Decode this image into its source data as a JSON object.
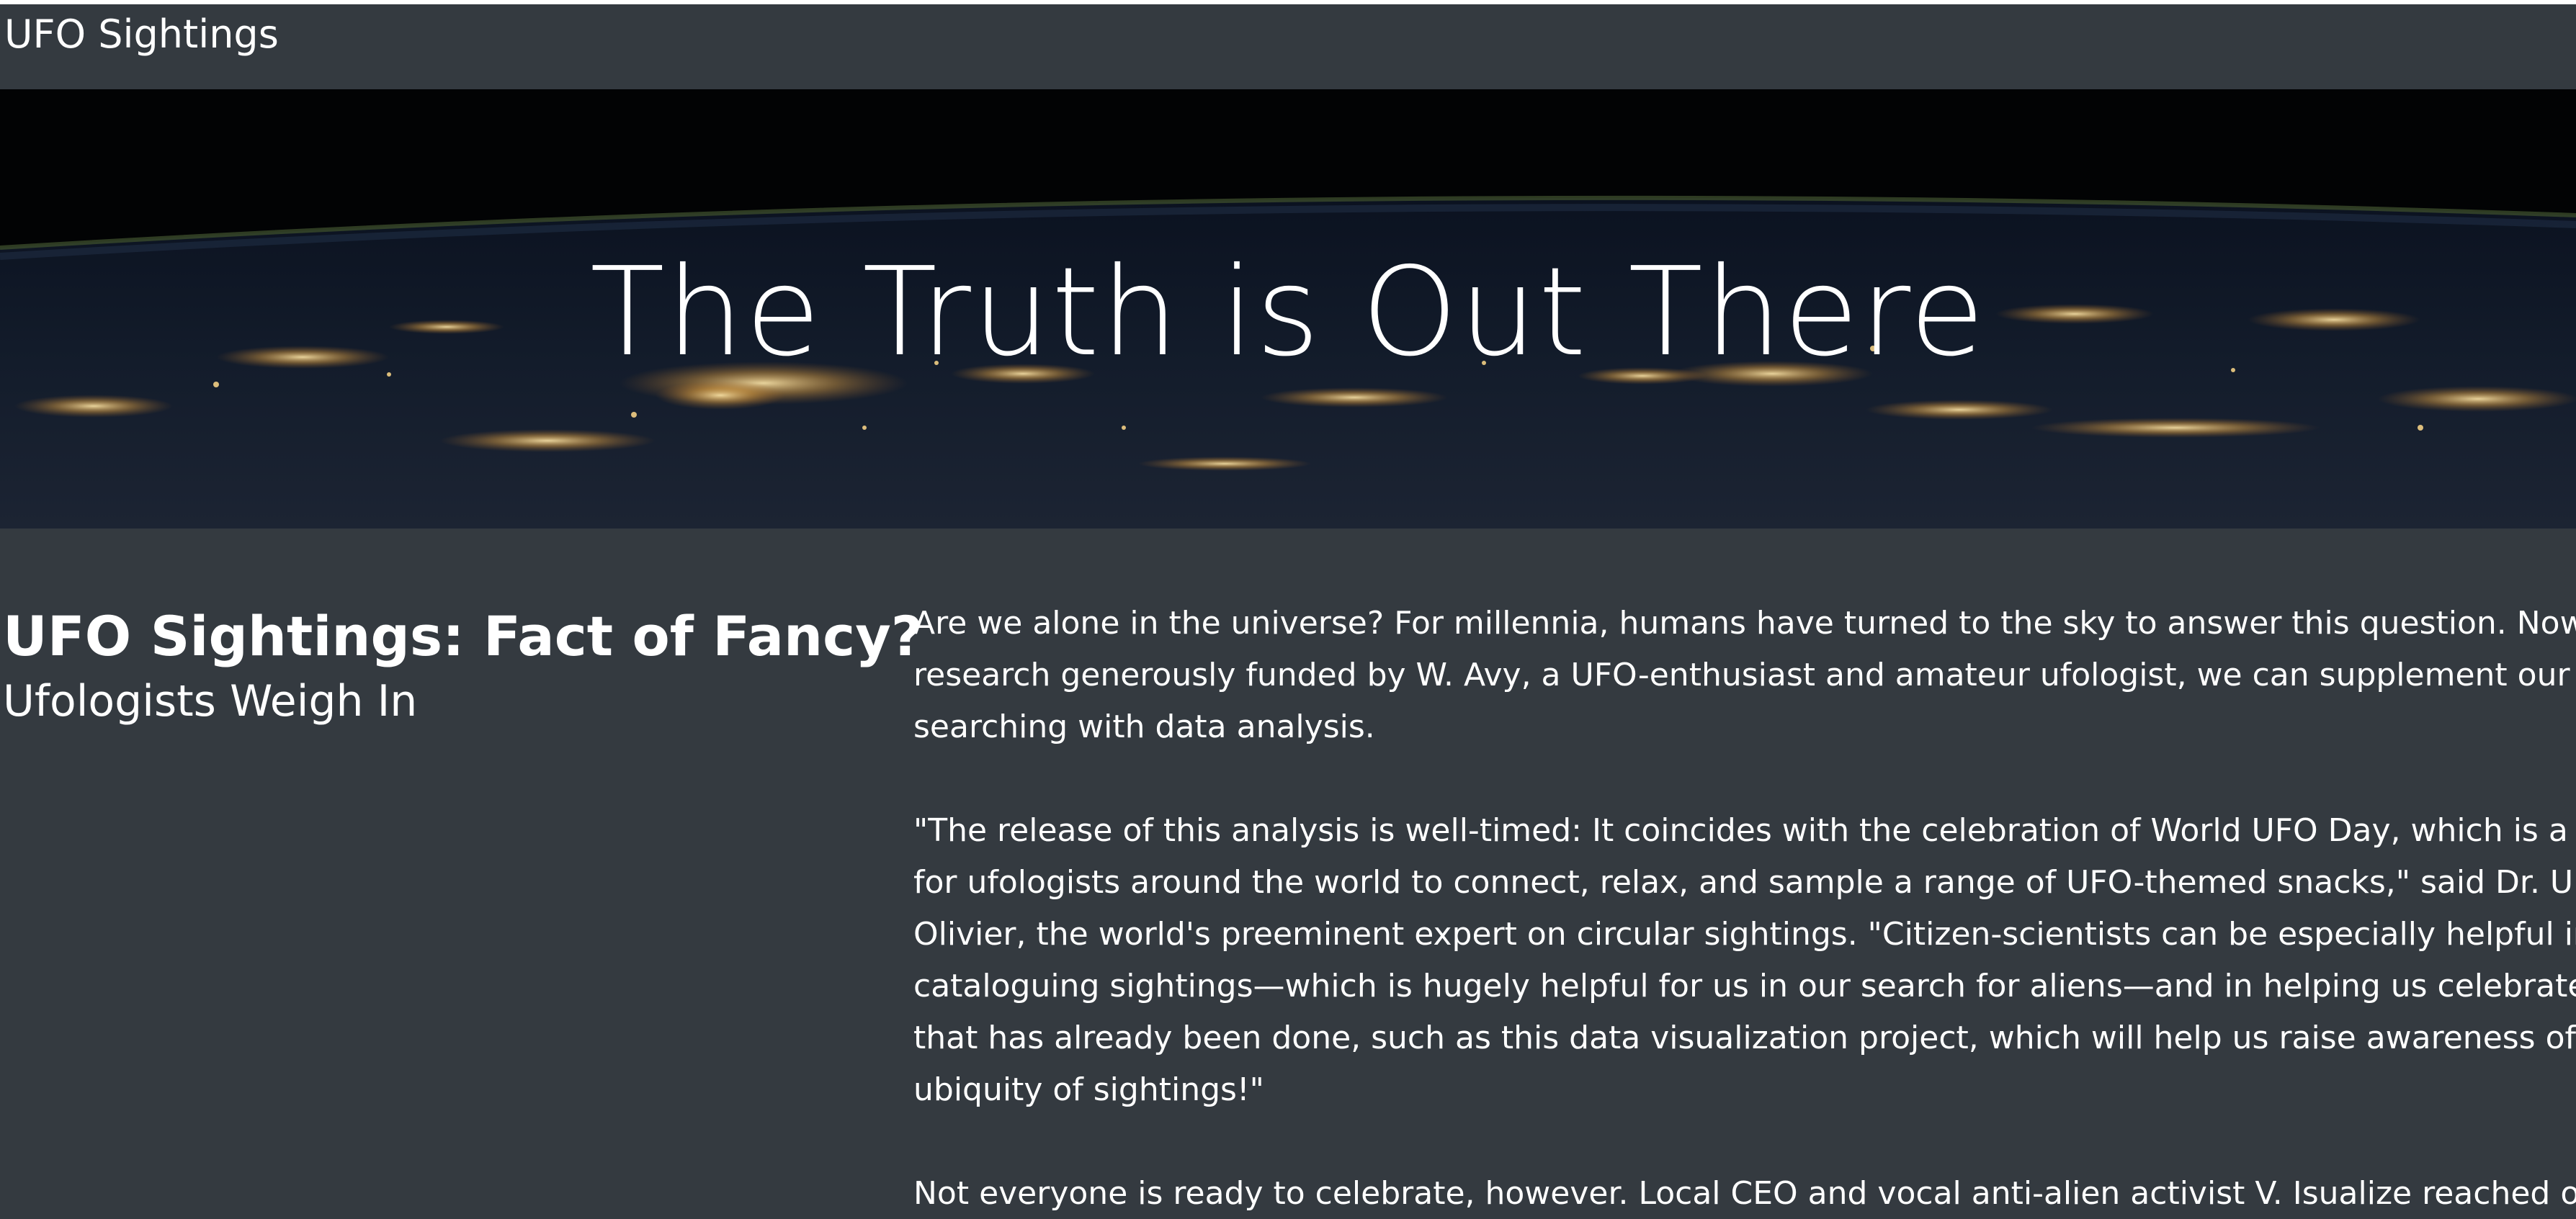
{
  "navbar": {
    "brand": "UFO Sightings"
  },
  "hero": {
    "title": "The Truth is Out There",
    "background": "earth-at-night-from-space"
  },
  "article": {
    "title": "UFO Sightings: Fact of Fancy?",
    "subtitle": "Ufologists Weigh In",
    "paragraphs": [
      {
        "lines": [
          "Are we alone in the universe? For millennia, humans have turned to the sky to answer this question. Now, thar",
          "research generously funded by W. Avy, a UFO-enthusiast and amateur ufologist, we can supplement our sky-",
          "searching with data analysis."
        ]
      },
      {
        "lines": [
          "\"The release of this analysis is well-timed: It coincides with the celebration of World UFO Day, which is a mom",
          "for ufologists around the world to connect, relax, and sample a range of UFO-themed snacks,\" said Dr. Ursula",
          "Olivier, the world's preeminent expert on circular sightings. \"Citizen-scientists can be especially helpful in both",
          "cataloguing sightings—which is hugely helpful for us in our search for aliens—and in helping us celebrate the",
          "that has already been done, such as this data visualization project, which will help us raise awareness of the",
          "ubiquity of sightings!\""
        ]
      },
      {
        "lines": [
          "Not everyone is ready to celebrate, however. Local CEO and vocal anti-alien activist V. Isualize reached out to"
        ]
      }
    ]
  },
  "colors": {
    "navbar_bg": "#343a40",
    "page_bg": "#343a40",
    "text": "#ffffff"
  }
}
